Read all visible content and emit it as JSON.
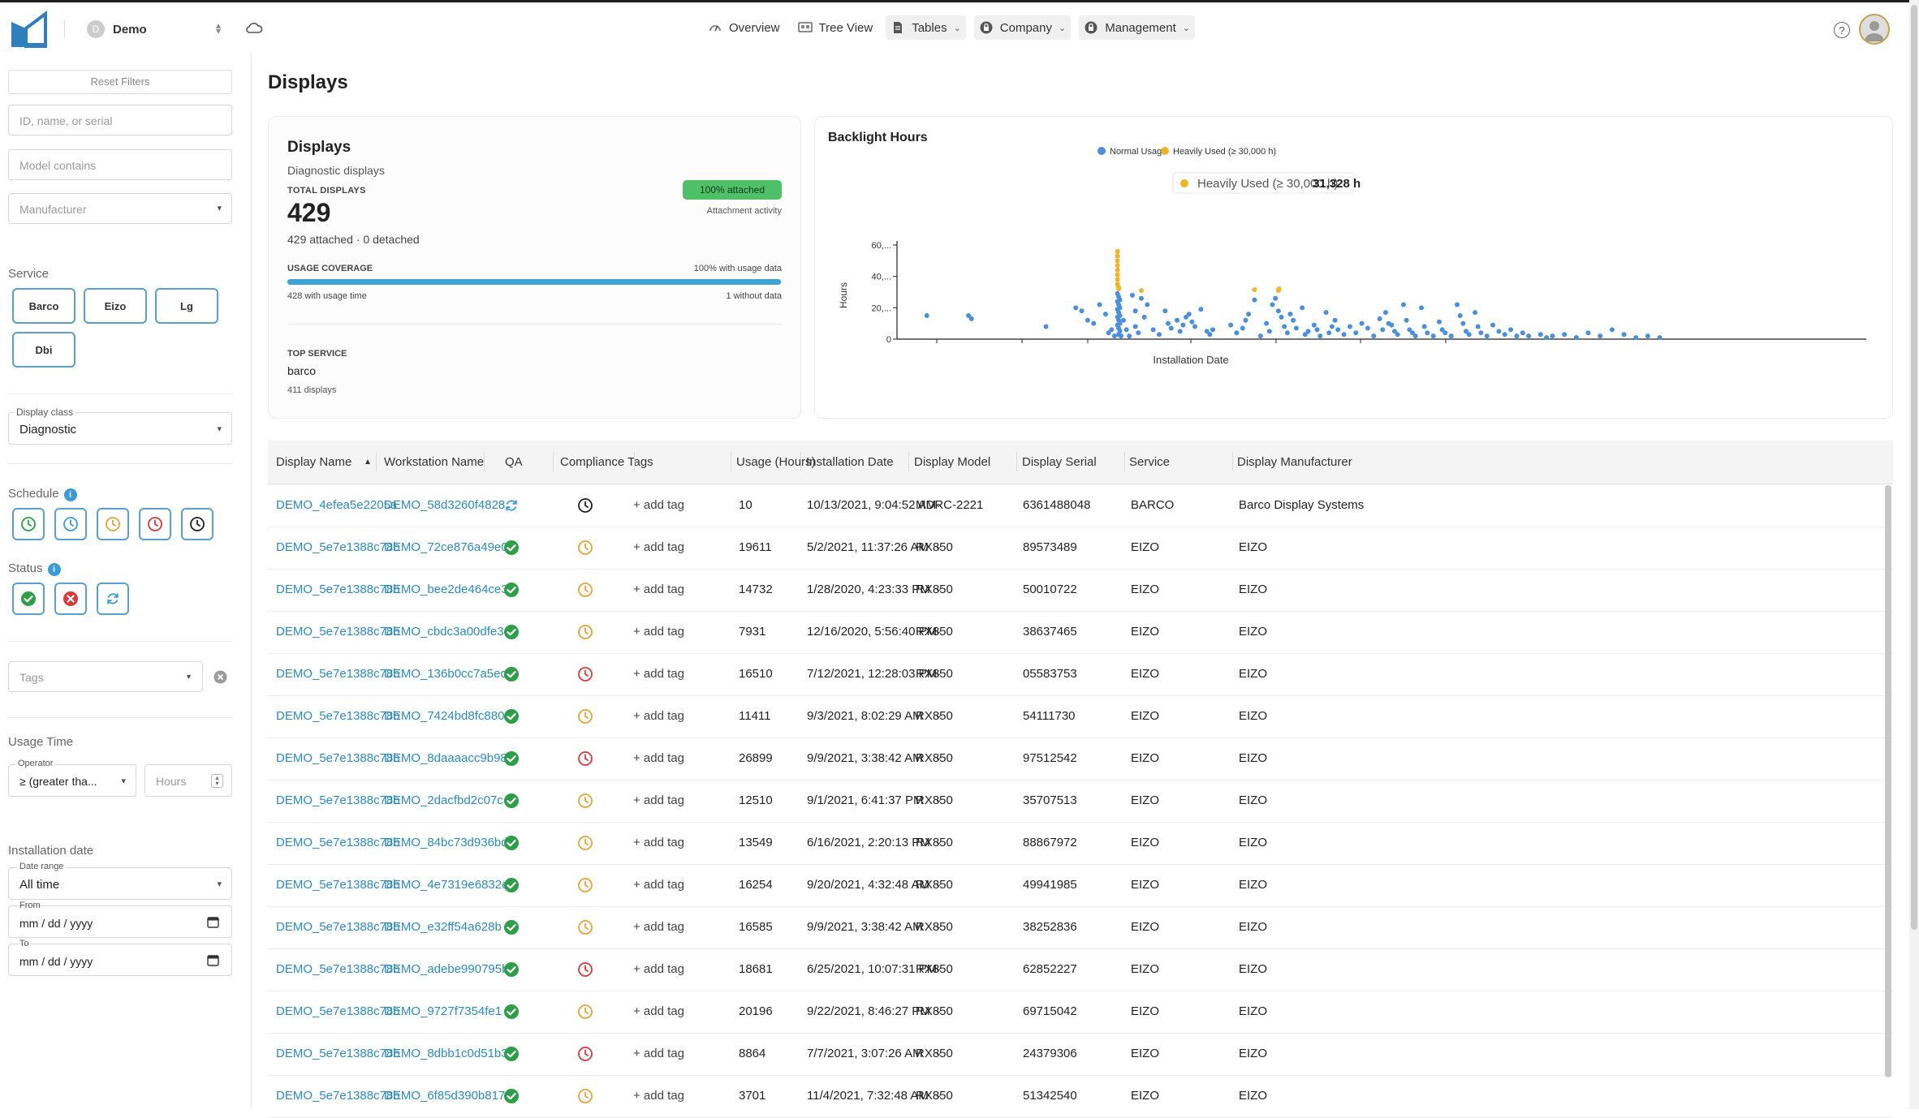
{
  "header": {
    "org_initial": "D",
    "org_name": "Demo",
    "nav": [
      {
        "label": "Overview",
        "icon": "gauge-icon",
        "dropdown": false
      },
      {
        "label": "Tree View",
        "icon": "tree-icon",
        "dropdown": false
      },
      {
        "label": "Tables",
        "icon": "document-icon",
        "dropdown": true
      },
      {
        "label": "Company",
        "icon": "lock-icon",
        "dropdown": true
      },
      {
        "label": "Management",
        "icon": "lock-icon",
        "dropdown": true
      }
    ],
    "help": "?"
  },
  "sidebar": {
    "reset_filters": "Reset Filters",
    "search_placeholder": "ID, name, or serial",
    "model_placeholder": "Model contains",
    "manufacturer_placeholder": "Manufacturer",
    "service_label": "Service",
    "services": [
      "Barco",
      "Eizo",
      "Lg",
      "Dbi"
    ],
    "display_class_label": "Display class",
    "display_class_value": "Diagnostic",
    "schedule_label": "Schedule",
    "status_label": "Status",
    "tags_placeholder": "Tags",
    "usage_time_label": "Usage Time",
    "operator_label": "Operator",
    "operator_value": "≥ (greater tha...",
    "hours_placeholder": "Hours",
    "installation_date_label": "Installation date",
    "date_range_label": "Date range",
    "date_range_value": "All time",
    "from_label": "From",
    "from_value": "mm / dd / yyyy",
    "to_label": "To",
    "to_value": "mm / dd / yyyy",
    "colors": {
      "accent": "#5a9fd4",
      "green": "#2e9e48",
      "red": "#d93a3a",
      "orange": "#e8a33b"
    }
  },
  "page": {
    "title": "Displays"
  },
  "summary": {
    "title": "Displays",
    "subtitle": "Diagnostic displays",
    "total_label": "TOTAL DISPLAYS",
    "attached_badge": "100% attached",
    "attachment_activity": "Attachment activity",
    "total_value": "429",
    "attached_detail": "429 attached · 0 detached",
    "usage_coverage_label": "USAGE COVERAGE",
    "usage_coverage_pct_text": "100% with usage data",
    "usage_coverage_fraction": 0.998,
    "with_usage_time": "428 with usage time",
    "without_data": "1 without data",
    "top_service_label": "TOP SERVICE",
    "top_service_value": "barco",
    "top_service_count": "411 displays"
  },
  "chart_data": {
    "type": "scatter",
    "title": "Backlight Hours",
    "xlabel": "Installation Date",
    "ylabel": "Hours",
    "yticks": [
      "0",
      "20,...",
      "40,...",
      "60,..."
    ],
    "ylim": [
      0,
      60000
    ],
    "legend_position": "top-center",
    "series": [
      {
        "name": "Normal Usage",
        "color": "#4a8fdc"
      },
      {
        "name": "Heavily Used (≥ 30,000 h)",
        "color": "#f0b429"
      }
    ],
    "tooltip": {
      "label": "Heavily Used (≥ 30,000 h)",
      "value": "31,328 h"
    },
    "normal_points": [
      [
        0.05,
        15000
      ],
      [
        0.12,
        15000
      ],
      [
        0.125,
        13000
      ],
      [
        0.25,
        8000
      ],
      [
        0.3,
        20000
      ],
      [
        0.31,
        18000
      ],
      [
        0.32,
        12000
      ],
      [
        0.33,
        10000
      ],
      [
        0.34,
        22000
      ],
      [
        0.35,
        16000
      ],
      [
        0.36,
        6000
      ],
      [
        0.355,
        4000
      ],
      [
        0.365,
        2000
      ],
      [
        0.37,
        9000
      ],
      [
        0.37,
        14000
      ],
      [
        0.37,
        19000
      ],
      [
        0.37,
        24000
      ],
      [
        0.37,
        29000
      ],
      [
        0.372,
        27000
      ],
      [
        0.372,
        22000
      ],
      [
        0.372,
        17000
      ],
      [
        0.372,
        12000
      ],
      [
        0.372,
        7000
      ],
      [
        0.372,
        3000
      ],
      [
        0.374,
        25000
      ],
      [
        0.374,
        20000
      ],
      [
        0.374,
        15000
      ],
      [
        0.374,
        10000
      ],
      [
        0.374,
        5000
      ],
      [
        0.376,
        2000
      ],
      [
        0.38,
        12000
      ],
      [
        0.385,
        6000
      ],
      [
        0.39,
        2000
      ],
      [
        0.395,
        28000
      ],
      [
        0.4,
        18000
      ],
      [
        0.4,
        8000
      ],
      [
        0.405,
        4000
      ],
      [
        0.41,
        26000
      ],
      [
        0.415,
        14000
      ],
      [
        0.42,
        22000
      ],
      [
        0.43,
        6000
      ],
      [
        0.44,
        3000
      ],
      [
        0.45,
        18000
      ],
      [
        0.455,
        10000
      ],
      [
        0.46,
        7000
      ],
      [
        0.47,
        12000
      ],
      [
        0.475,
        5000
      ],
      [
        0.48,
        9000
      ],
      [
        0.485,
        14000
      ],
      [
        0.49,
        16000
      ],
      [
        0.495,
        11000
      ],
      [
        0.5,
        8000
      ],
      [
        0.51,
        19000
      ],
      [
        0.52,
        5000
      ],
      [
        0.525,
        3000
      ],
      [
        0.53,
        6000
      ],
      [
        0.56,
        9000
      ],
      [
        0.57,
        4000
      ],
      [
        0.58,
        7000
      ],
      [
        0.585,
        12000
      ],
      [
        0.59,
        16000
      ],
      [
        0.6,
        25000
      ],
      [
        0.61,
        2000
      ],
      [
        0.62,
        10000
      ],
      [
        0.625,
        5000
      ],
      [
        0.63,
        22000
      ],
      [
        0.635,
        26000
      ],
      [
        0.64,
        18000
      ],
      [
        0.645,
        14000
      ],
      [
        0.65,
        8000
      ],
      [
        0.655,
        4000
      ],
      [
        0.66,
        16000
      ],
      [
        0.665,
        12000
      ],
      [
        0.67,
        7000
      ],
      [
        0.68,
        20000
      ],
      [
        0.685,
        3000
      ],
      [
        0.69,
        5000
      ],
      [
        0.7,
        9000
      ],
      [
        0.705,
        6000
      ],
      [
        0.71,
        2000
      ],
      [
        0.72,
        17000
      ],
      [
        0.725,
        4000
      ],
      [
        0.73,
        8000
      ],
      [
        0.735,
        12000
      ],
      [
        0.74,
        6000
      ],
      [
        0.75,
        3000
      ],
      [
        0.76,
        8000
      ],
      [
        0.77,
        4000
      ],
      [
        0.78,
        10000
      ],
      [
        0.79,
        7000
      ],
      [
        0.8,
        2000
      ],
      [
        0.81,
        13000
      ],
      [
        0.815,
        6000
      ],
      [
        0.82,
        17000
      ],
      [
        0.825,
        10000
      ],
      [
        0.83,
        9000
      ],
      [
        0.835,
        5000
      ],
      [
        0.84,
        3000
      ],
      [
        0.85,
        22000
      ],
      [
        0.855,
        12000
      ],
      [
        0.86,
        6000
      ],
      [
        0.865,
        4000
      ],
      [
        0.87,
        2000
      ],
      [
        0.88,
        20000
      ],
      [
        0.885,
        8000
      ],
      [
        0.89,
        4000
      ],
      [
        0.9,
        2000
      ],
      [
        0.91,
        11000
      ],
      [
        0.915,
        6000
      ],
      [
        0.92,
        4000
      ],
      [
        0.93,
        2000
      ],
      [
        0.94,
        22000
      ],
      [
        0.945,
        15000
      ],
      [
        0.95,
        10000
      ],
      [
        0.955,
        5000
      ],
      [
        0.96,
        3000
      ],
      [
        0.97,
        17000
      ],
      [
        0.975,
        8000
      ],
      [
        0.98,
        4000
      ],
      [
        0.99,
        2000
      ],
      [
        1.0,
        9000
      ],
      [
        1.01,
        5000
      ],
      [
        1.02,
        3000
      ],
      [
        1.03,
        6000
      ],
      [
        1.04,
        2000
      ],
      [
        1.05,
        4000
      ],
      [
        1.06,
        2000
      ],
      [
        1.08,
        3000
      ],
      [
        1.09,
        1000
      ],
      [
        1.1,
        2000
      ],
      [
        1.12,
        3000
      ],
      [
        1.14,
        1000
      ],
      [
        1.16,
        4000
      ],
      [
        1.18,
        2000
      ],
      [
        1.2,
        6000
      ],
      [
        1.22,
        3000
      ],
      [
        1.24,
        1000
      ],
      [
        1.26,
        2000
      ],
      [
        1.28,
        1000
      ]
    ],
    "heavy_points": [
      [
        0.37,
        35000
      ],
      [
        0.37,
        38000
      ],
      [
        0.37,
        41000
      ],
      [
        0.37,
        44000
      ],
      [
        0.37,
        47000
      ],
      [
        0.37,
        50000
      ],
      [
        0.37,
        53000
      ],
      [
        0.37,
        56000
      ],
      [
        0.372,
        32000
      ],
      [
        0.372,
        33000
      ],
      [
        0.41,
        31000
      ],
      [
        0.6,
        31500
      ],
      [
        0.64,
        31000
      ],
      [
        0.641,
        32000
      ]
    ]
  },
  "table": {
    "columns": [
      "Display Name",
      "Workstation Name",
      "QA",
      "Compliance",
      "Tags",
      "Usage (Hours)",
      "Installation Date",
      "Display Model",
      "Display Serial",
      "Service",
      "Display Manufacturer"
    ],
    "sort_indicator": "▲",
    "add_tag": "+ add tag",
    "rows": [
      {
        "name": "DEMO_4efea5e2205a",
        "ws": "DEMO_58d3260f4828",
        "qa": "sync",
        "comp": "black",
        "usage": "10",
        "date": "10/13/2021, 9:04:52 AM",
        "model": "MDRC-2221",
        "serial": "6361488048",
        "service": "BARCO",
        "mfr": "Barco Display Systems"
      },
      {
        "name": "DEMO_5e7e1388c78b",
        "ws": "DEMO_72ce876a49e0",
        "qa": "ok",
        "comp": "orange",
        "usage": "19611",
        "date": "5/2/2021, 11:37:26 AM",
        "model": "RX850",
        "serial": "89573489",
        "service": "EIZO",
        "mfr": "EIZO"
      },
      {
        "name": "DEMO_5e7e1388c78b",
        "ws": "DEMO_bee2de464ce3",
        "qa": "ok",
        "comp": "orange",
        "usage": "14732",
        "date": "1/28/2020, 4:23:33 PM",
        "model": "RX850",
        "serial": "50010722",
        "service": "EIZO",
        "mfr": "EIZO"
      },
      {
        "name": "DEMO_5e7e1388c78b",
        "ws": "DEMO_cbdc3a00dfe3",
        "qa": "ok",
        "comp": "orange",
        "usage": "7931",
        "date": "12/16/2020, 5:56:40 PM",
        "model": "RX850",
        "serial": "38637465",
        "service": "EIZO",
        "mfr": "EIZO"
      },
      {
        "name": "DEMO_5e7e1388c78b",
        "ws": "DEMO_136b0cc7a5ec",
        "qa": "ok",
        "comp": "red",
        "usage": "16510",
        "date": "7/12/2021, 12:28:03 PM",
        "model": "RX850",
        "serial": "05583753",
        "service": "EIZO",
        "mfr": "EIZO"
      },
      {
        "name": "DEMO_5e7e1388c78b",
        "ws": "DEMO_7424bd8fc880",
        "qa": "ok",
        "comp": "orange",
        "usage": "11411",
        "date": "9/3/2021, 8:02:29 AM",
        "model": "RX850",
        "serial": "54111730",
        "service": "EIZO",
        "mfr": "EIZO"
      },
      {
        "name": "DEMO_5e7e1388c78b",
        "ws": "DEMO_8daaaacc9b98",
        "qa": "ok",
        "comp": "red",
        "usage": "26899",
        "date": "9/9/2021, 3:38:42 AM",
        "model": "RX850",
        "serial": "97512542",
        "service": "EIZO",
        "mfr": "EIZO"
      },
      {
        "name": "DEMO_5e7e1388c78b",
        "ws": "DEMO_2dacfbd2c07c",
        "qa": "ok",
        "comp": "orange",
        "usage": "12510",
        "date": "9/1/2021, 6:41:37 PM",
        "model": "RX850",
        "serial": "35707513",
        "service": "EIZO",
        "mfr": "EIZO"
      },
      {
        "name": "DEMO_5e7e1388c78b",
        "ws": "DEMO_84bc73d936bd",
        "qa": "ok",
        "comp": "orange",
        "usage": "13549",
        "date": "6/16/2021, 2:20:13 PM",
        "model": "RX850",
        "serial": "88867972",
        "service": "EIZO",
        "mfr": "EIZO"
      },
      {
        "name": "DEMO_5e7e1388c78b",
        "ws": "DEMO_4e7319e6832e",
        "qa": "ok",
        "comp": "orange",
        "usage": "16254",
        "date": "9/20/2021, 4:32:48 AM",
        "model": "RX850",
        "serial": "49941985",
        "service": "EIZO",
        "mfr": "EIZO"
      },
      {
        "name": "DEMO_5e7e1388c78b",
        "ws": "DEMO_e32ff54a628b",
        "qa": "ok",
        "comp": "orange",
        "usage": "16585",
        "date": "9/9/2021, 3:38:42 AM",
        "model": "RX850",
        "serial": "38252836",
        "service": "EIZO",
        "mfr": "EIZO"
      },
      {
        "name": "DEMO_5e7e1388c78b",
        "ws": "DEMO_adebe990795b",
        "qa": "ok",
        "comp": "red",
        "usage": "18681",
        "date": "6/25/2021, 10:07:31 PM",
        "model": "RX850",
        "serial": "62852227",
        "service": "EIZO",
        "mfr": "EIZO"
      },
      {
        "name": "DEMO_5e7e1388c78b",
        "ws": "DEMO_9727f7354fe1",
        "qa": "ok",
        "comp": "orange",
        "usage": "20196",
        "date": "9/22/2021, 8:46:27 PM",
        "model": "RX850",
        "serial": "69715042",
        "service": "EIZO",
        "mfr": "EIZO"
      },
      {
        "name": "DEMO_5e7e1388c78b",
        "ws": "DEMO_8dbb1c0d51b3",
        "qa": "ok",
        "comp": "red",
        "usage": "8864",
        "date": "7/7/2021, 3:07:26 AM",
        "model": "RX850",
        "serial": "24379306",
        "service": "EIZO",
        "mfr": "EIZO"
      },
      {
        "name": "DEMO_5e7e1388c78b",
        "ws": "DEMO_6f85d390b817",
        "qa": "ok",
        "comp": "orange",
        "usage": "3701",
        "date": "11/4/2021, 7:32:48 AM",
        "model": "RX850",
        "serial": "51342540",
        "service": "EIZO",
        "mfr": "EIZO"
      }
    ]
  }
}
